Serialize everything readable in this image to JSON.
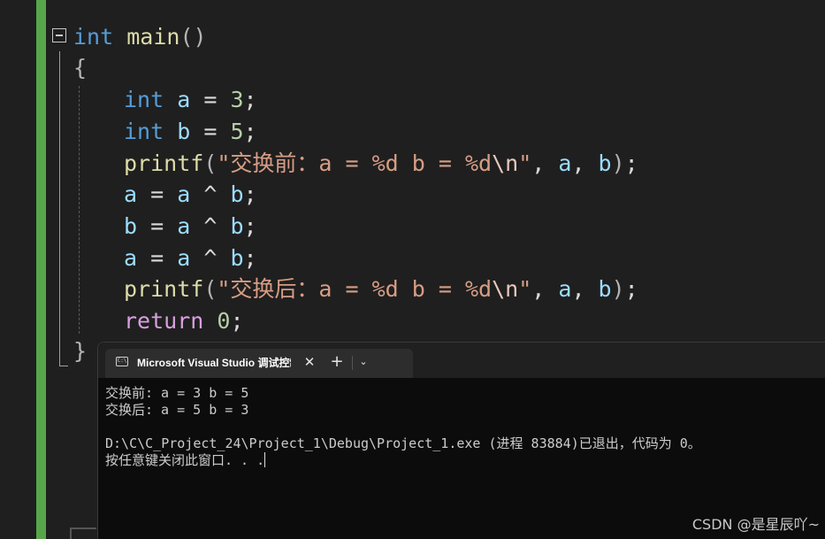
{
  "editor": {
    "lines": [
      {
        "parts": [
          [
            "kw",
            "int"
          ],
          [
            "plain",
            " "
          ],
          [
            "fn",
            "main"
          ],
          [
            "punc",
            "()"
          ]
        ]
      },
      {
        "parts": [
          [
            "punc",
            "{"
          ]
        ]
      },
      {
        "parts": [
          [
            "kw",
            "int"
          ],
          [
            "plain",
            " "
          ],
          [
            "var",
            "a"
          ],
          [
            "plain",
            " = "
          ],
          [
            "num",
            "3"
          ],
          [
            "plain",
            ";"
          ]
        ]
      },
      {
        "parts": [
          [
            "kw",
            "int"
          ],
          [
            "plain",
            " "
          ],
          [
            "var",
            "b"
          ],
          [
            "plain",
            " = "
          ],
          [
            "num",
            "5"
          ],
          [
            "plain",
            ";"
          ]
        ]
      },
      {
        "parts": [
          [
            "fn",
            "printf"
          ],
          [
            "punc",
            "("
          ],
          [
            "str",
            "\"交换前：a = %d b = %d"
          ],
          [
            "esc",
            "\\n"
          ],
          [
            "str",
            "\""
          ],
          [
            "plain",
            ", "
          ],
          [
            "var",
            "a"
          ],
          [
            "plain",
            ", "
          ],
          [
            "var",
            "b"
          ],
          [
            "punc",
            ")"
          ],
          [
            "plain",
            ";"
          ]
        ]
      },
      {
        "parts": [
          [
            "var",
            "a"
          ],
          [
            "plain",
            " = "
          ],
          [
            "var",
            "a"
          ],
          [
            "plain",
            " ^ "
          ],
          [
            "var",
            "b"
          ],
          [
            "plain",
            ";"
          ]
        ]
      },
      {
        "parts": [
          [
            "var",
            "b"
          ],
          [
            "plain",
            " = "
          ],
          [
            "var",
            "a"
          ],
          [
            "plain",
            " ^ "
          ],
          [
            "var",
            "b"
          ],
          [
            "plain",
            ";"
          ]
        ]
      },
      {
        "parts": [
          [
            "var",
            "a"
          ],
          [
            "plain",
            " = "
          ],
          [
            "var",
            "a"
          ],
          [
            "plain",
            " ^ "
          ],
          [
            "var",
            "b"
          ],
          [
            "plain",
            ";"
          ]
        ]
      },
      {
        "parts": [
          [
            "fn",
            "printf"
          ],
          [
            "punc",
            "("
          ],
          [
            "str",
            "\"交换后：a = %d b = %d"
          ],
          [
            "esc",
            "\\n"
          ],
          [
            "str",
            "\""
          ],
          [
            "plain",
            ", "
          ],
          [
            "var",
            "a"
          ],
          [
            "plain",
            ", "
          ],
          [
            "var",
            "b"
          ],
          [
            "punc",
            ")"
          ],
          [
            "plain",
            ";"
          ]
        ]
      },
      {
        "parts": [
          [
            "ctrl",
            "return"
          ],
          [
            "plain",
            " "
          ],
          [
            "num",
            "0"
          ],
          [
            "plain",
            ";"
          ]
        ]
      },
      {
        "parts": [
          [
            "punc",
            "}"
          ]
        ]
      }
    ]
  },
  "console": {
    "tab_title": "Microsoft Visual Studio 调试控制台",
    "tab_icon_text": "C:\\",
    "close_glyph": "✕",
    "new_tab_glyph": "+",
    "dropdown_glyph": "⌄",
    "output": [
      "交换前: a = 3 b = 5",
      "交换后: a = 5 b = 3",
      "",
      "D:\\C\\C_Project_24\\Project_1\\Debug\\Project_1.exe (进程 83884)已退出，代码为 0。",
      "按任意键关闭此窗口. . ."
    ]
  },
  "watermark": "CSDN @是星辰吖~"
}
